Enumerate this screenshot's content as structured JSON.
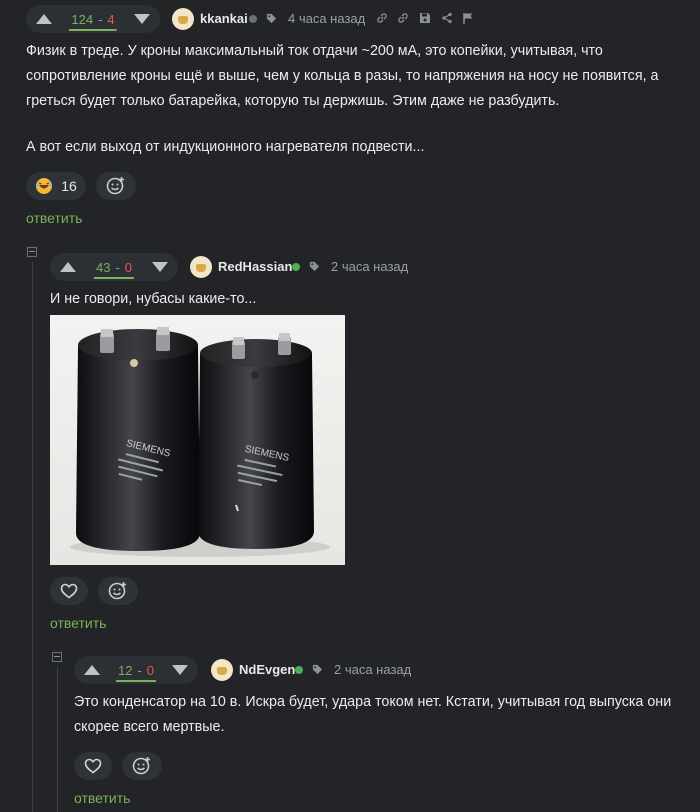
{
  "comment1": {
    "score_plus": "124",
    "score_sep": "-",
    "score_minus": "4",
    "author": "kkankai",
    "time": "4 часа назад",
    "text_1": "Физик в треде. У кроны максимальный ток отдачи ~200 мА, это копейки, учитывая, что",
    "text_2": "сопротивление кроны ещё и выше, чем у кольца в разы, то напряжения на носу не появится, а",
    "text_3": "греться будет только батарейка, которую ты держишь. Этим даже не разбудить.",
    "text_4": "А вот если выход от индукционного нагревателя подвести...",
    "reaction_count": "16",
    "reply": "ответить"
  },
  "comment2": {
    "score_plus": "43",
    "score_sep": "-",
    "score_minus": "0",
    "author": "RedHassian",
    "time": "2 часа назад",
    "text": "И не говори, нубасы какие-то...",
    "image_label_1": "SIEMENS",
    "image_label_2": "SIEMENS",
    "reply": "ответить"
  },
  "comment3": {
    "score_plus": "12",
    "score_sep": "-",
    "score_minus": "0",
    "author": "NdEvgen",
    "time": "2 часа назад",
    "text_1": "Это конденсатор на 10 в. Искра будет, удара током нет. Кстати, учитывая год выпуска они",
    "text_2": "скорее всего мертвые.",
    "reply": "ответить"
  },
  "colors": {
    "background": "#222427",
    "accent_green": "#7ab35b",
    "minus_red": "#e4594d",
    "online_dot": "#4caf50"
  },
  "icons": [
    "arrow-up-icon",
    "arrow-down-icon",
    "tag-icon",
    "link-icon",
    "save-icon",
    "share-icon",
    "flag-icon",
    "heart-icon",
    "add-reaction-icon",
    "collapse-icon"
  ]
}
